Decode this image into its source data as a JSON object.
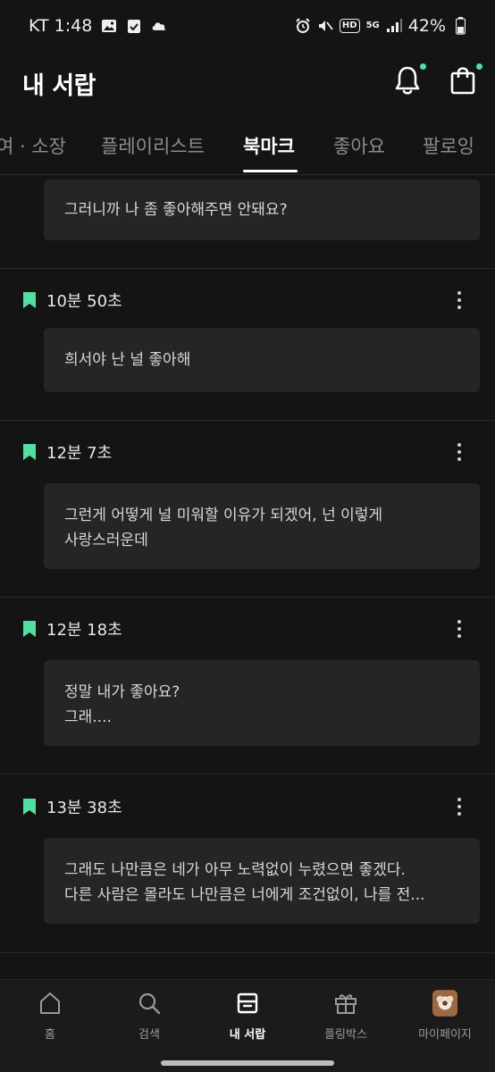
{
  "status_bar": {
    "carrier_time": "KT 1:48",
    "network": "5G",
    "hd_label": "HD",
    "battery": "42%"
  },
  "header": {
    "title": "내 서랍",
    "accent_color": "#4fe1a1"
  },
  "tabs": [
    {
      "label": "여 · 소장",
      "active": false
    },
    {
      "label": "플레이리스트",
      "active": false
    },
    {
      "label": "북마크",
      "active": true
    },
    {
      "label": "좋아요",
      "active": false
    },
    {
      "label": "팔로잉",
      "active": false
    }
  ],
  "bookmarks": [
    {
      "time": "",
      "lines": [
        "그러니까 나 좀 좋아해주면 안돼요?"
      ]
    },
    {
      "time": "10분 50초",
      "lines": [
        "희서야 난 널 좋아해"
      ]
    },
    {
      "time": "12분 7초",
      "lines": [
        "그런게 어떻게 널 미워할 이유가 되겠어, 넌 이렇게",
        "사랑스러운데"
      ]
    },
    {
      "time": "12분 18초",
      "lines": [
        "정말 내가 좋아요?",
        "그래...."
      ]
    },
    {
      "time": "13분 38초",
      "lines": [
        "그래도 나만큼은 네가 아무 노력없이 누렸으면 좋겠다.",
        "다른 사람은 몰라도 나만큼은 너에게 조건없이, 나를 전..."
      ]
    }
  ],
  "bottom_nav": [
    {
      "label": "홈",
      "icon": "home-icon",
      "active": false
    },
    {
      "label": "검색",
      "icon": "search-icon",
      "active": false
    },
    {
      "label": "내 서랍",
      "icon": "drawer-icon",
      "active": true
    },
    {
      "label": "플링박스",
      "icon": "gift-icon",
      "active": false
    },
    {
      "label": "마이페이지",
      "icon": "avatar",
      "active": false
    }
  ]
}
